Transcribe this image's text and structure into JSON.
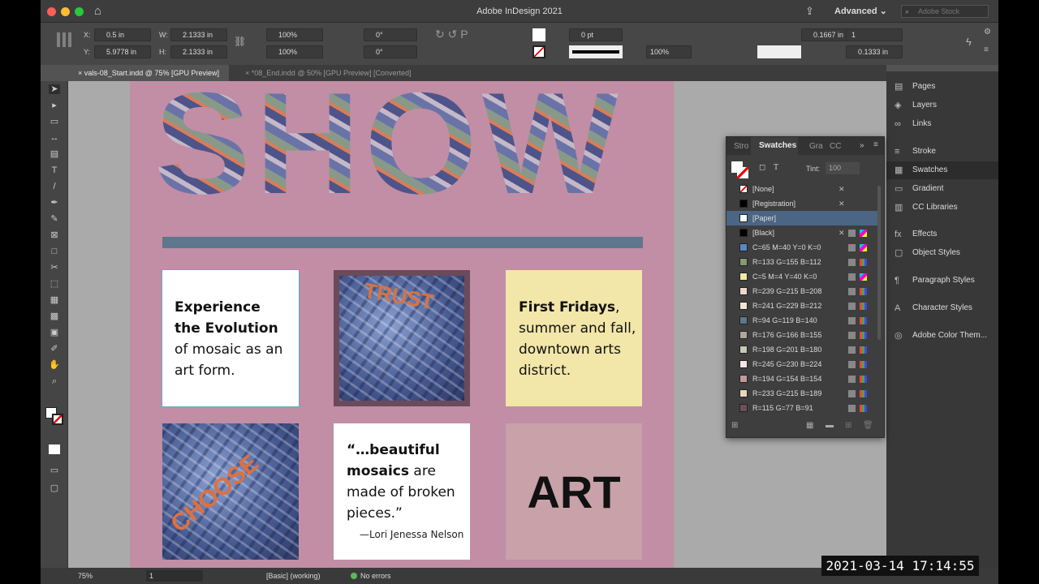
{
  "app": {
    "title": "Adobe InDesign 2021",
    "workspace": "Advanced",
    "stock_placeholder": "Adobe Stock"
  },
  "control": {
    "x": "0.5 in",
    "y": "5.9778 in",
    "w": "2.1333 in",
    "h": "2.1333 in",
    "x_label": "X:",
    "y_label": "Y:",
    "w_label": "W:",
    "h_label": "H:",
    "scale_x": "100%",
    "scale_y": "100%",
    "rotate": "0°",
    "shear": "0°",
    "stroke_weight": "0 pt",
    "opacity": "100%",
    "inset": "0.1667 in",
    "columns": "1",
    "gutter": "0.1333 in"
  },
  "tabs": [
    {
      "label": "vals-08_Start.indd @ 75% [GPU Preview]"
    },
    {
      "label": "*08_End.indd @ 50% [GPU Preview] [Converted]"
    }
  ],
  "page": {
    "headline": "SHOW",
    "card1": {
      "bold": "Experience the Evolution",
      "rest": " of mosaic as an art form."
    },
    "card2_word": "TRUST",
    "card3": {
      "bold": "First Fridays",
      "rest": ", summer and fall, downtown arts district."
    },
    "card4_word": "CHOOSE",
    "quote": {
      "bold1": "“…beautiful mosaics",
      "rest": " are made of broken pieces.”",
      "author": "—Lori Jenessa Nelson"
    },
    "card6": "ART"
  },
  "dock": [
    "Pages",
    "Layers",
    "Links",
    "Stroke",
    "Swatches",
    "Gradient",
    "CC Libraries",
    "Effects",
    "Object Styles",
    "Paragraph Styles",
    "Character Styles",
    "Adobe Color Them..."
  ],
  "swatches_panel": {
    "tabs": [
      "Stro",
      "Swatches",
      "Gra",
      "CC"
    ],
    "tint_label": "Tint:",
    "tint": "100",
    "items": [
      {
        "name": "[None]",
        "color": "none"
      },
      {
        "name": "[Registration]",
        "color": "#000000"
      },
      {
        "name": "[Paper]",
        "color": "#ffffff"
      },
      {
        "name": "[Black]",
        "color": "#000000"
      },
      {
        "name": "C=65 M=40 Y=0 K=0",
        "color": "#5b86c6"
      },
      {
        "name": "R=133 G=155 B=112",
        "color": "#859b70"
      },
      {
        "name": "C=5 M=4 Y=40 K=0",
        "color": "#f0e9a6"
      },
      {
        "name": "R=239 G=215 B=208",
        "color": "#efd7d0"
      },
      {
        "name": "R=241 G=229 B=212",
        "color": "#f1e5d4"
      },
      {
        "name": "R=94 G=119 B=140",
        "color": "#5e778c"
      },
      {
        "name": "R=176 G=166 B=155",
        "color": "#b0a69b"
      },
      {
        "name": "R=198 G=201 B=180",
        "color": "#c6c9b4"
      },
      {
        "name": "R=245 G=230 B=224",
        "color": "#f5e6e0"
      },
      {
        "name": "R=194 G=154 B=154",
        "color": "#c29a9a"
      },
      {
        "name": "R=233 G=215 B=189",
        "color": "#e9d7bd"
      },
      {
        "name": "R=115 G=77 B=91",
        "color": "#734d5b"
      }
    ]
  },
  "status": {
    "zoom": "75%",
    "page": "1",
    "preflight_profile": "[Basic] (working)",
    "errors": "No errors"
  },
  "timestamp": "2021-03-14  17:14:55"
}
